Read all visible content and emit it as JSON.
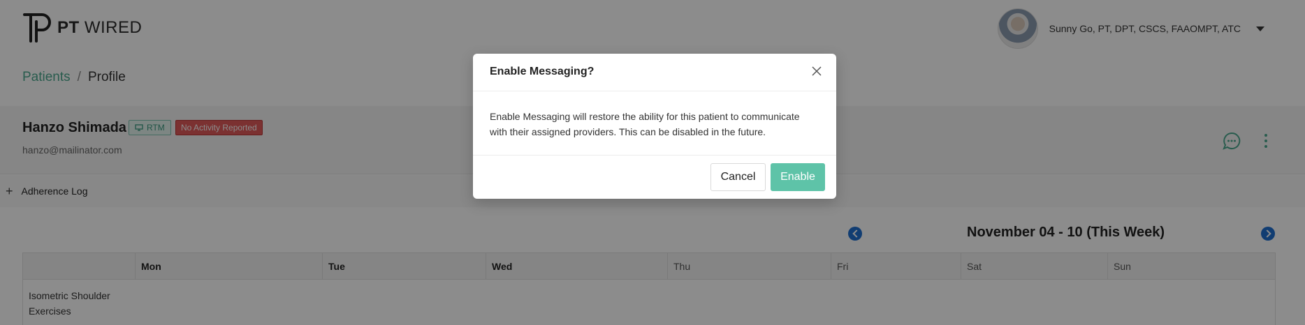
{
  "header": {
    "logo_bold": "PT",
    "logo_light": "WIRED",
    "user_name": "Sunny Go, PT, DPT, CSCS, FAAOMPT, ATC"
  },
  "breadcrumb": {
    "parent": "Patients",
    "separator": "/",
    "current": "Profile"
  },
  "patient": {
    "name": "Hanzo Shimada",
    "tag_rtm": "RTM",
    "tag_status": "No Activity Reported",
    "email": "hanzo@mailinator.com"
  },
  "adherence": {
    "label": "Adherence Log"
  },
  "calendar": {
    "week_title": "November 04 - 10 (This Week)",
    "days": [
      "Mon",
      "Tue",
      "Wed",
      "Thu",
      "Fri",
      "Sat",
      "Sun"
    ],
    "rows": [
      {
        "label": "Isometric Shoulder Exercises"
      }
    ]
  },
  "modal": {
    "title": "Enable Messaging?",
    "body": "Enable Messaging will restore the ability for this patient to communicate with their assigned providers. This can be disabled in the future.",
    "cancel_label": "Cancel",
    "enable_label": "Enable"
  },
  "colors": {
    "accent": "#5ec3a8",
    "link": "#4ca88e",
    "danger": "#e05a5a",
    "nav": "#1f6fd0"
  }
}
